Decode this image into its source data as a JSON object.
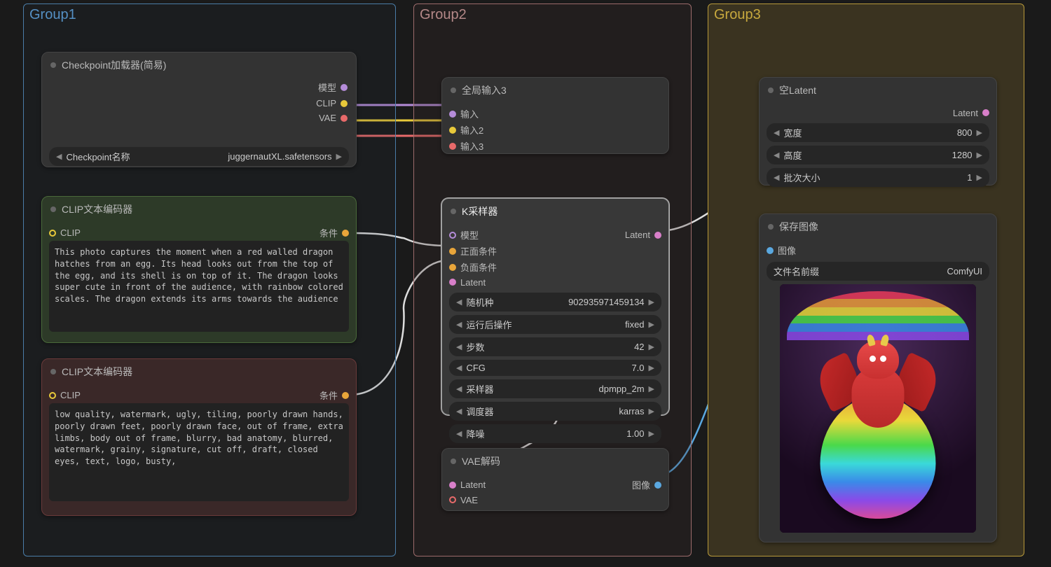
{
  "groups": {
    "g1": "Group1",
    "g2": "Group2",
    "g3": "Group3"
  },
  "checkpoint": {
    "title": "Checkpoint加载器(简易)",
    "out_model": "模型",
    "out_clip": "CLIP",
    "out_vae": "VAE",
    "widget_label": "Checkpoint名称",
    "widget_value": "juggernautXL.safetensors"
  },
  "clip_pos": {
    "title": "CLIP文本编码器",
    "in": "CLIP",
    "out": "条件",
    "text": "This photo captures the moment when a red walled dragon hatches from an egg. Its head looks out from the top of the egg, and its shell is on top of it. The dragon looks super cute in front of the audience, with rainbow colored scales. The dragon extends its arms towards the audience"
  },
  "clip_neg": {
    "title": "CLIP文本编码器",
    "in": "CLIP",
    "out": "条件",
    "text": "low quality, watermark, ugly, tiling, poorly drawn hands, poorly drawn feet, poorly drawn face, out of frame, extra limbs, body out of frame, blurry, bad anatomy, blurred, watermark, grainy, signature, cut off, draft, closed eyes, text, logo, busty,"
  },
  "reroute": {
    "title": "全局输入3",
    "in1": "输入",
    "in2": "输入2",
    "in3": "输入3"
  },
  "ksampler": {
    "title": "K采样器",
    "in_model": "模型",
    "in_pos": "正面条件",
    "in_neg": "负面条件",
    "in_latent": "Latent",
    "out_latent": "Latent",
    "w_seed": {
      "label": "随机种",
      "value": "902935971459134"
    },
    "w_after": {
      "label": "运行后操作",
      "value": "fixed"
    },
    "w_steps": {
      "label": "步数",
      "value": "42"
    },
    "w_cfg": {
      "label": "CFG",
      "value": "7.0"
    },
    "w_sampler": {
      "label": "采样器",
      "value": "dpmpp_2m"
    },
    "w_sched": {
      "label": "调度器",
      "value": "karras"
    },
    "w_denoise": {
      "label": "降噪",
      "value": "1.00"
    }
  },
  "vaedec": {
    "title": "VAE解码",
    "in_latent": "Latent",
    "in_vae": "VAE",
    "out_image": "图像"
  },
  "emptylatent": {
    "title": "空Latent",
    "out": "Latent",
    "w_w": {
      "label": "宽度",
      "value": "800"
    },
    "w_h": {
      "label": "高度",
      "value": "1280"
    },
    "w_b": {
      "label": "批次大小",
      "value": "1"
    }
  },
  "save": {
    "title": "保存图像",
    "in_image": "图像",
    "w_prefix": {
      "label": "文件名前缀",
      "value": "ComfyUI"
    }
  }
}
